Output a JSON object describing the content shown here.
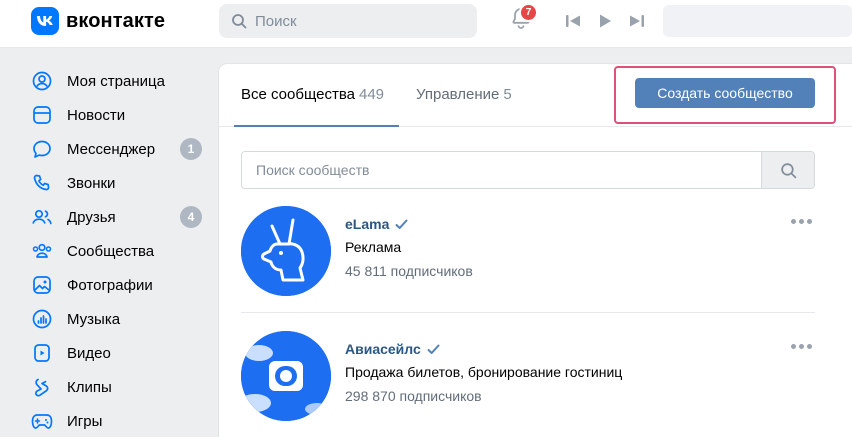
{
  "header": {
    "logo_text": "вконтакте",
    "search_placeholder": "Поиск",
    "notifications_count": "7",
    "colors": {
      "brand": "#0077ff",
      "badge": "#e64646"
    }
  },
  "sidebar": {
    "items": [
      {
        "label": "Моя страница",
        "icon": "user-circle-icon"
      },
      {
        "label": "Новости",
        "icon": "news-icon"
      },
      {
        "label": "Мессенджер",
        "icon": "message-icon",
        "count": "1"
      },
      {
        "label": "Звонки",
        "icon": "phone-icon"
      },
      {
        "label": "Друзья",
        "icon": "friends-icon",
        "count": "4"
      },
      {
        "label": "Сообщества",
        "icon": "communities-icon"
      },
      {
        "label": "Фотографии",
        "icon": "photo-icon"
      },
      {
        "label": "Музыка",
        "icon": "music-icon"
      },
      {
        "label": "Видео",
        "icon": "video-icon"
      },
      {
        "label": "Клипы",
        "icon": "clips-icon"
      },
      {
        "label": "Игры",
        "icon": "games-icon"
      }
    ]
  },
  "main": {
    "tabs": [
      {
        "label": "Все сообщества",
        "count": "449"
      },
      {
        "label": "Управление",
        "count": "5"
      }
    ],
    "create_button": "Создать сообщество",
    "search_placeholder": "Поиск сообществ",
    "groups": [
      {
        "name": "eLama",
        "description": "Реклама",
        "subscribers": "45 811 подписчиков",
        "verified": true
      },
      {
        "name": "Авиасейлс",
        "description": "Продажа билетов, бронирование гостиниц",
        "subscribers": "298 870 подписчиков",
        "verified": true
      }
    ],
    "colors": {
      "accent": "#5181b8",
      "highlight": "#e0507a",
      "link": "#2a5885"
    }
  }
}
